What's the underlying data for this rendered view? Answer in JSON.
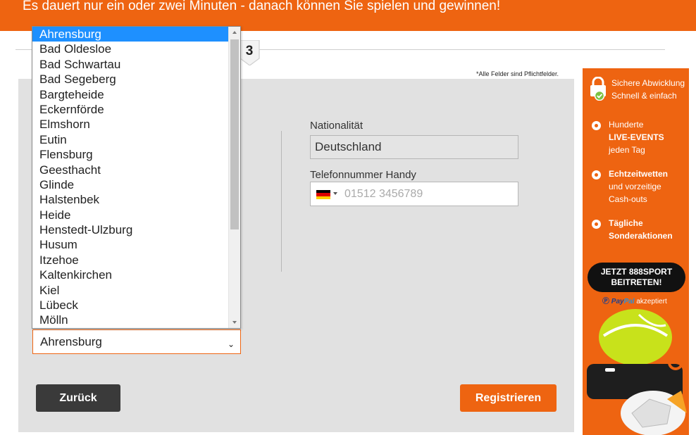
{
  "banner": {
    "text": "Es dauert nur ein oder zwei Minuten - danach können Sie spielen und gewinnen!"
  },
  "stepper": {
    "current_step": "3"
  },
  "form": {
    "required_note": "*Alle Felder sind Pflichtfelder.",
    "nationality": {
      "label": "Nationalität",
      "value": "Deutschland"
    },
    "phone": {
      "label": "Telefonnummer Handy",
      "placeholder": "01512 3456789",
      "country_flag": "de-flag-icon"
    },
    "city_select": {
      "selected": "Ahrensburg",
      "options": [
        "Ahrensburg",
        "Bad Oldesloe",
        "Bad Schwartau",
        "Bad Segeberg",
        "Bargteheide",
        "Eckernförde",
        "Elmshorn",
        "Eutin",
        "Flensburg",
        "Geesthacht",
        "Glinde",
        "Halstenbek",
        "Heide",
        "Henstedt-Ulzburg",
        "Husum",
        "Itzehoe",
        "Kaltenkirchen",
        "Kiel",
        "Lübeck",
        "Mölln"
      ]
    },
    "back_button": "Zurück",
    "register_button": "Registrieren"
  },
  "sidebar": {
    "secure_line1": "Sichere Abwicklung",
    "secure_line2": "Schnell & einfach",
    "features": [
      {
        "line1": "Hunderte",
        "line2": "LIVE-EVENTS",
        "line3": "jeden Tag"
      },
      {
        "line1": "Echtzeitwetten",
        "line2": "und vorzeitige",
        "line3": "Cash-outs"
      },
      {
        "line1": "Tägliche",
        "line2": "Sonderaktionen"
      }
    ],
    "join_line1": "JETZT 888SPORT",
    "join_line2": "BEITRETEN!",
    "paypal_word1": "Pay",
    "paypal_word2": "Pal",
    "paypal_suffix": "akzeptiert"
  },
  "colors": {
    "brand_orange": "#ee6411",
    "panel_gray": "#e1e1e1",
    "dark_button": "#3a3a3a",
    "selected_blue": "#1e90ff"
  }
}
